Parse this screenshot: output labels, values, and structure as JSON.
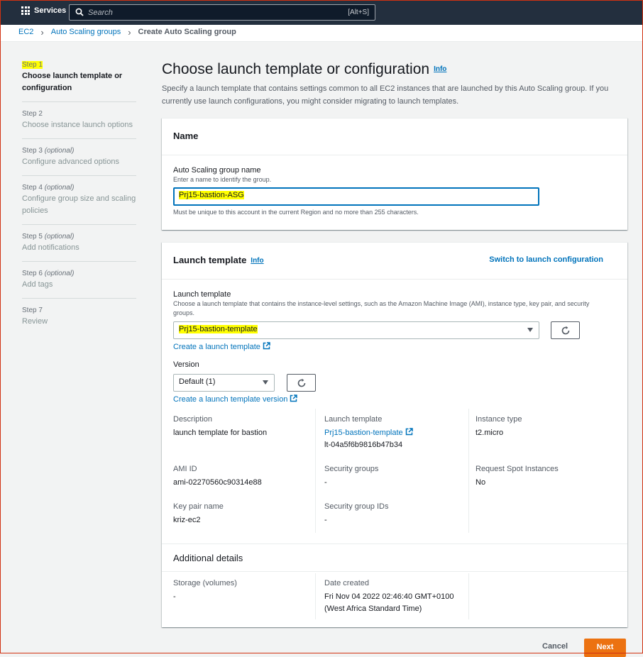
{
  "topbar": {
    "services_label": "Services",
    "search_placeholder": "Search",
    "search_shortcut": "[Alt+S]"
  },
  "breadcrumb": {
    "items": [
      "EC2",
      "Auto Scaling groups"
    ],
    "current": "Create Auto Scaling group"
  },
  "sidebar": {
    "steps": [
      {
        "num": "Step 1",
        "optional": "",
        "title": "Choose launch template or configuration",
        "active": true
      },
      {
        "num": "Step 2",
        "optional": "",
        "title": "Choose instance launch options"
      },
      {
        "num": "Step 3",
        "optional": "(optional)",
        "title": "Configure advanced options"
      },
      {
        "num": "Step 4",
        "optional": "(optional)",
        "title": "Configure group size and scaling policies"
      },
      {
        "num": "Step 5",
        "optional": "(optional)",
        "title": "Add notifications"
      },
      {
        "num": "Step 6",
        "optional": "(optional)",
        "title": "Add tags"
      },
      {
        "num": "Step 7",
        "optional": "",
        "title": "Review"
      }
    ]
  },
  "main": {
    "title": "Choose launch template or configuration",
    "info": "Info",
    "description": "Specify a launch template that contains settings common to all EC2 instances that are launched by this Auto Scaling group. If you currently use launch configurations, you might consider migrating to launch templates."
  },
  "name_panel": {
    "heading": "Name",
    "field_label": "Auto Scaling group name",
    "field_hint": "Enter a name to identify the group.",
    "field_value": "Prj15-bastion-ASG",
    "field_constraint": "Must be unique to this account in the current Region and no more than 255 characters."
  },
  "launch_panel": {
    "heading": "Launch template",
    "info": "Info",
    "switch_link": "Switch to launch configuration",
    "template_label": "Launch template",
    "template_hint": "Choose a launch template that contains the instance-level settings, such as the Amazon Machine Image (AMI), instance type, key pair, and security groups.",
    "template_value": "Prj15-bastion-template",
    "create_template_link": "Create a launch template",
    "version_label": "Version",
    "version_value": "Default (1)",
    "create_version_link": "Create a launch template version",
    "details": {
      "description_label": "Description",
      "description_value": "launch template for bastion",
      "launch_template_label": "Launch template",
      "launch_template_link": "Prj15-bastion-template",
      "launch_template_id": "lt-04a5f6b9816b47b34",
      "instance_type_label": "Instance type",
      "instance_type_value": "t2.micro",
      "ami_label": "AMI ID",
      "ami_value": "ami-02270560c90314e88",
      "security_groups_label": "Security groups",
      "security_groups_value": "-",
      "spot_label": "Request Spot Instances",
      "spot_value": "No",
      "key_pair_label": "Key pair name",
      "key_pair_value": "kriz-ec2",
      "sg_ids_label": "Security group IDs",
      "sg_ids_value": "-"
    },
    "additional": {
      "heading": "Additional details",
      "storage_label": "Storage (volumes)",
      "storage_value": "-",
      "date_label": "Date created",
      "date_value": "Fri Nov 04 2022 02:46:40 GMT+0100",
      "date_zone": "(West Africa Standard Time)"
    }
  },
  "footer": {
    "cancel": "Cancel",
    "next": "Next"
  }
}
